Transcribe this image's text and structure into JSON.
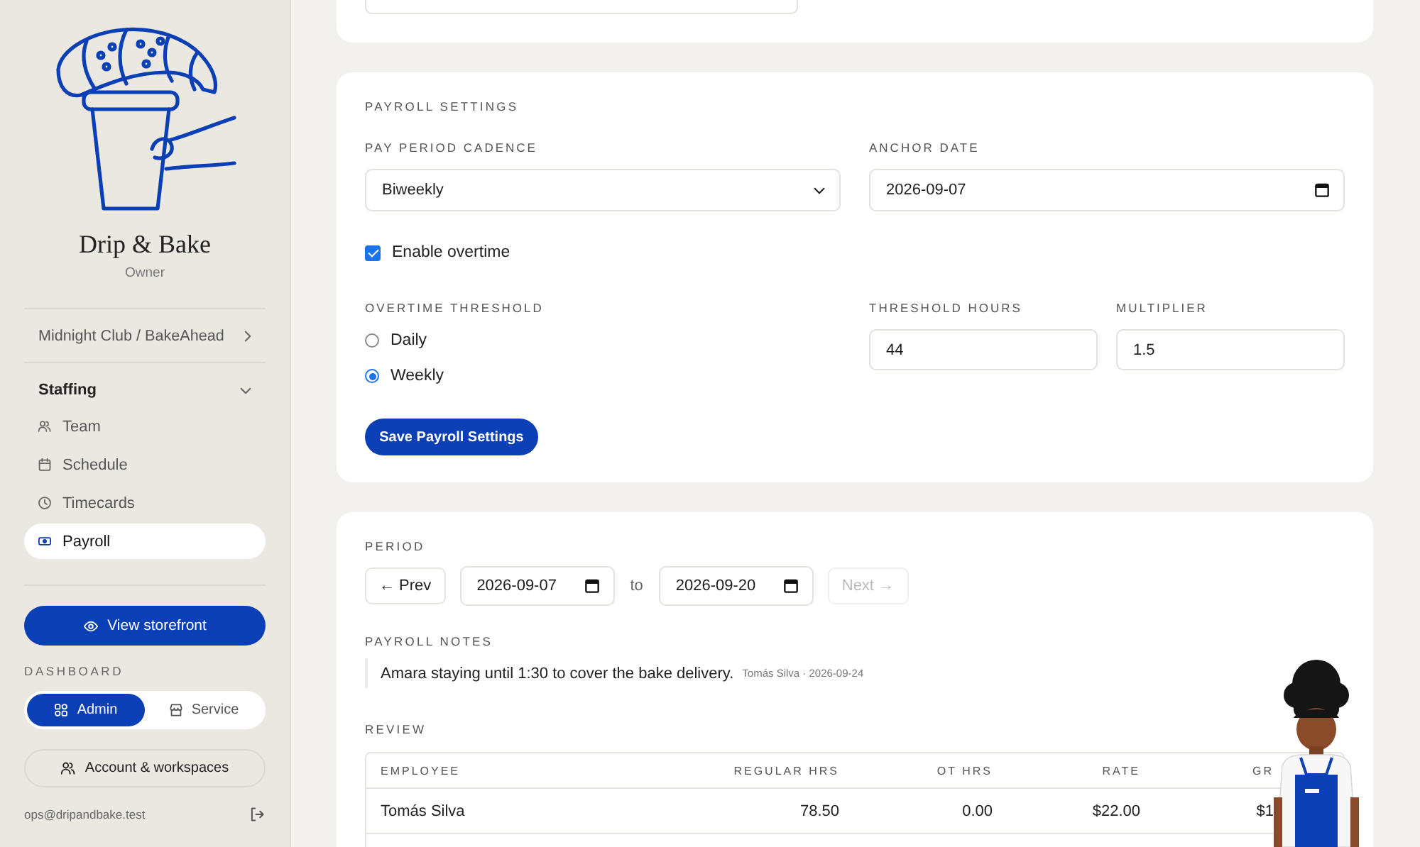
{
  "sidebar": {
    "brand": {
      "name": "Drip & Bake",
      "role": "Owner"
    },
    "workspace": {
      "label": "Midnight Club / BakeAhead"
    },
    "section": {
      "title": "Staffing",
      "expanded": true,
      "items": [
        {
          "label": "Team",
          "selected": false
        },
        {
          "label": "Schedule",
          "selected": false
        },
        {
          "label": "Timecards",
          "selected": false
        },
        {
          "label": "Payroll",
          "selected": true
        }
      ]
    },
    "storefront_button": "View storefront",
    "dashboard": {
      "title": "DASHBOARD",
      "options": [
        {
          "label": "Admin",
          "selected": true
        },
        {
          "label": "Service",
          "selected": false
        }
      ]
    },
    "account_button": "Account & workspaces",
    "email": "ops@dripandbake.test"
  },
  "payroll_settings": {
    "title": "PAYROLL SETTINGS",
    "cadence": {
      "label": "PAY PERIOD CADENCE",
      "value": "Biweekly"
    },
    "anchor_date": {
      "label": "ANCHOR DATE",
      "value": "2026-09-07"
    },
    "overtime": {
      "label": "Enable overtime",
      "checked": true
    },
    "threshold": {
      "label": "OVERTIME THRESHOLD",
      "options": [
        {
          "label": "Daily",
          "selected": false
        },
        {
          "label": "Weekly",
          "selected": true
        }
      ]
    },
    "threshold_hours": {
      "label": "THRESHOLD HOURS",
      "value": "44"
    },
    "multiplier": {
      "label": "MULTIPLIER",
      "value": "1.5"
    },
    "save_button": "Save Payroll Settings"
  },
  "period": {
    "title": "PERIOD",
    "prev_button": "← Prev",
    "start": "2026-09-07",
    "separator": "to",
    "end": "2026-09-20",
    "next_button": {
      "label": "Next →",
      "disabled": true
    }
  },
  "notes": {
    "title": "PAYROLL NOTES",
    "items": [
      {
        "text": "Amara staying until 1:30 to cover the bake delivery.",
        "meta": "Tomás Silva · 2026-09-24"
      }
    ]
  },
  "review": {
    "title": "REVIEW",
    "table": {
      "columns": [
        "EMPLOYEE",
        "REGULAR HRS",
        "OT HRS",
        "RATE",
        "GR"
      ],
      "rows": [
        [
          "Tomás Silva",
          "78.50",
          "0.00",
          "$22.00",
          "$1"
        ]
      ]
    }
  }
}
